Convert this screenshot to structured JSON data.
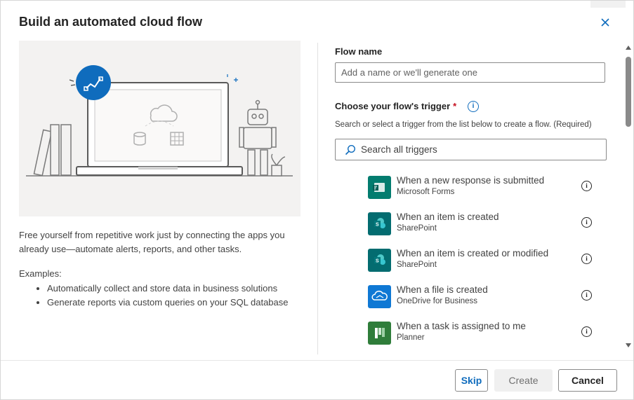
{
  "dialog": {
    "title": "Build an automated cloud flow"
  },
  "left": {
    "description": "Free yourself from repetitive work just by connecting the apps you already use—automate alerts, reports, and other tasks.",
    "examples_label": "Examples:",
    "examples": [
      "Automatically collect and store data in business solutions",
      "Generate reports via custom queries on your SQL database"
    ]
  },
  "form": {
    "flow_name_label": "Flow name",
    "flow_name_placeholder": "Add a name or we'll generate one",
    "flow_name_value": "",
    "trigger_label": "Choose your flow's trigger",
    "required_marker": "*",
    "trigger_help": "Search or select a trigger from the list below to create a flow. (Required)",
    "search_placeholder": "Search all triggers"
  },
  "triggers": [
    {
      "name": "When a new response is submitted",
      "connector": "Microsoft Forms",
      "icon": "forms-icon",
      "color": "#037c6f"
    },
    {
      "name": "When an item is created",
      "connector": "SharePoint",
      "icon": "sharepoint-icon",
      "color": "#036c70"
    },
    {
      "name": "When an item is created or modified",
      "connector": "SharePoint",
      "icon": "sharepoint-icon",
      "color": "#036c70"
    },
    {
      "name": "When a file is created",
      "connector": "OneDrive for Business",
      "icon": "onedrive-icon",
      "color": "#0f78d4"
    },
    {
      "name": "When a task is assigned to me",
      "connector": "Planner",
      "icon": "planner-icon",
      "color": "#2f7d3a"
    }
  ],
  "footer": {
    "skip_label": "Skip",
    "create_label": "Create",
    "cancel_label": "Cancel"
  },
  "colors": {
    "accent": "#0f6cbd",
    "required": "#c50f1f"
  }
}
